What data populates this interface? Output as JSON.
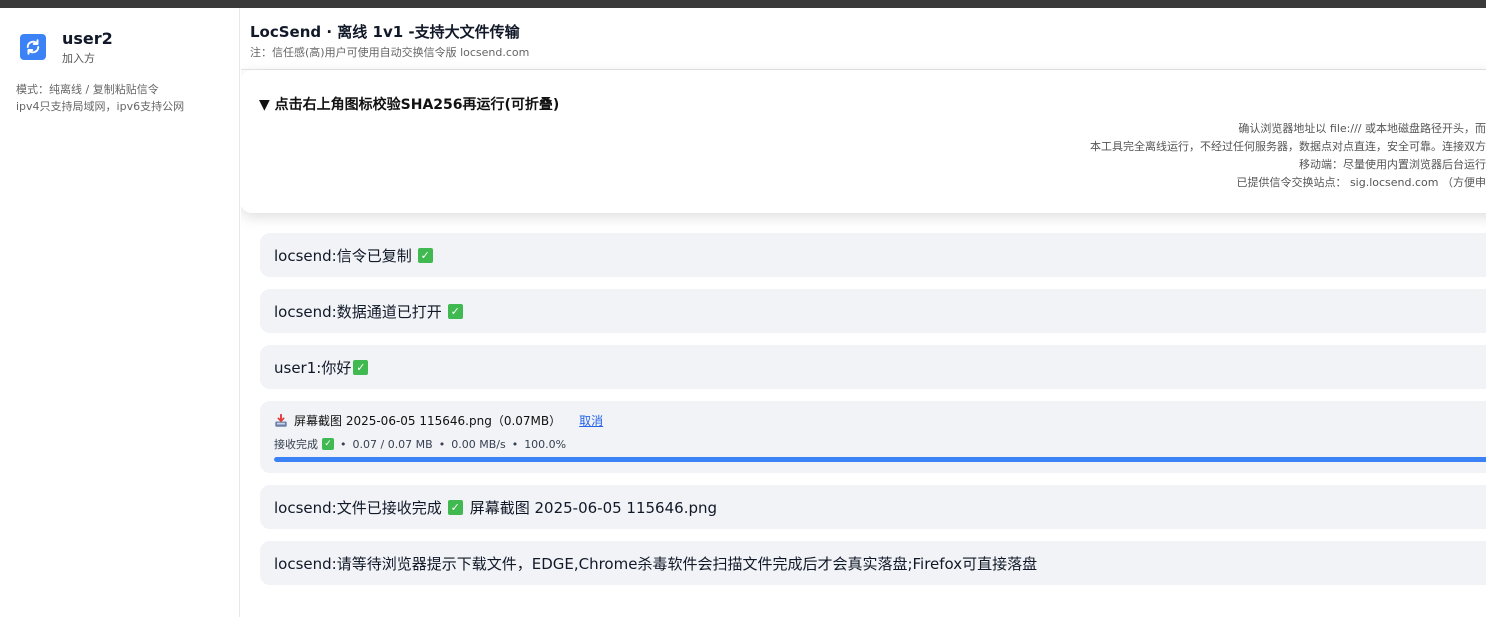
{
  "sidebar": {
    "user_name": "user2",
    "user_role": "加入方",
    "mode_line1": "模式：纯离线 / 复制粘贴信令",
    "mode_line2": "ipv4只支持局域网，ipv6支持公网"
  },
  "header": {
    "title": "LocSend · 离线 1v1 -支持大文件传输",
    "note": "注：信任感(高)用户可使用自动交换信令版 locsend.com"
  },
  "verify": {
    "summary": "▼ 点击右上角图标校验SHA256再运行(可折叠)",
    "lines": [
      "确认浏览器地址以 file:/// 或本地磁盘路径开头，而",
      "本工具完全离线运行，不经过任何服务器，数据点对点直连，安全可靠。连接双方",
      "移动端：尽量使用内置浏览器后台运行",
      "已提供信令交换站点： sig.locsend.com （方便申"
    ]
  },
  "messages": [
    {
      "text": "locsend:信令已复制",
      "check": true
    },
    {
      "text": "locsend:数据通道已打开",
      "check": true
    },
    {
      "text": "user1:你好",
      "check": true
    }
  ],
  "file": {
    "name": "屏幕截图 2025-06-05 115646.png（0.07MB）",
    "cancel_label": "取消",
    "status_label": "接收完成",
    "transferred": "0.07 / 0.07 MB",
    "speed": "0.00 MB/s",
    "percent_text": "100.0%",
    "progress": 1.0,
    "separator": "•"
  },
  "messages_after": [
    {
      "prefix": "locsend:文件已接收完成",
      "suffix": "屏幕截图 2025-06-05 115646.png"
    },
    {
      "prefix": "locsend:请等待浏览器提示下载文件，EDGE,Chrome杀毒软件会扫描文件完成后才会真实落盘;Firefox可直接落盘"
    }
  ],
  "icons": {
    "check": "✓"
  },
  "colors": {
    "accent": "#3b82f6",
    "check": "#3fb950",
    "link": "#2563eb",
    "bubble": "#f1f3f7"
  }
}
